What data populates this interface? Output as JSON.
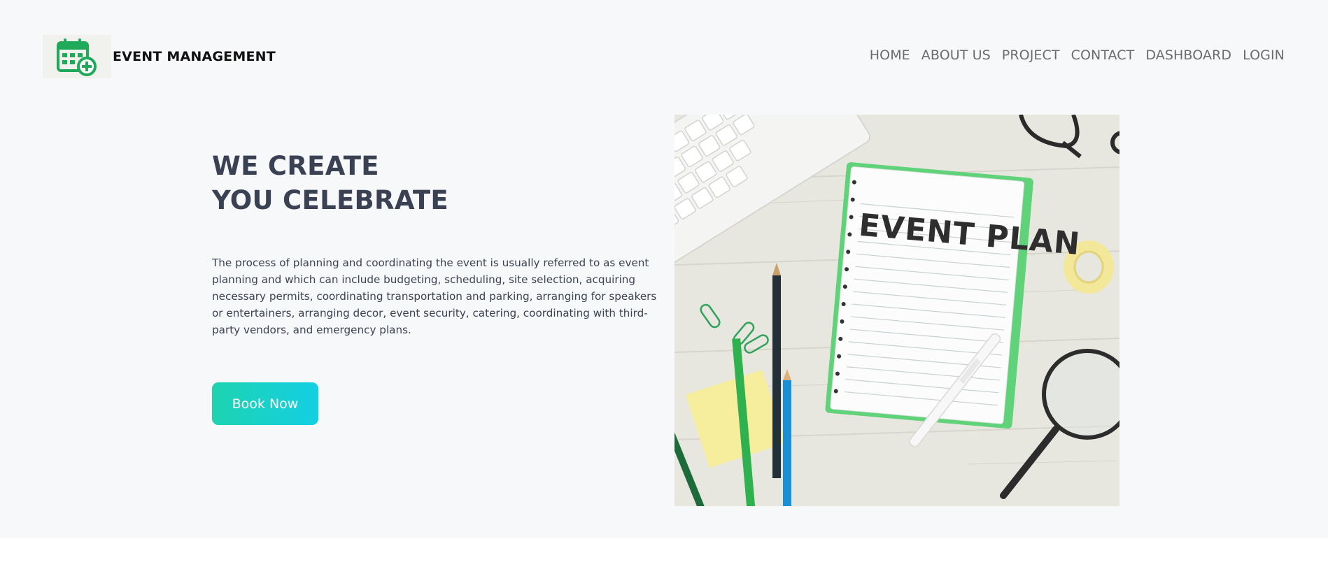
{
  "header": {
    "brand_name": "EVENT MANAGEMENT",
    "logo_icon": "calendar-plus-icon",
    "nav": [
      {
        "label": "HOME"
      },
      {
        "label": "ABOUT US"
      },
      {
        "label": "PROJECT"
      },
      {
        "label": "CONTACT"
      },
      {
        "label": "DASHBOARD"
      },
      {
        "label": "LOGIN"
      }
    ]
  },
  "hero": {
    "title_line1": "WE CREATE",
    "title_line2": "YOU CELEBRATE",
    "description": "The process of planning and coordinating the event is usually referred to as event planning and which can include budgeting, scheduling, site selection, acquiring necessary permits, coordinating transportation and parking, arranging for speakers or entertainers, arranging decor, event security, catering, coordinating with third-party vendors, and emergency plans.",
    "cta_label": "Book Now",
    "image": {
      "notebook_text": "EVENT PLAN"
    }
  },
  "colors": {
    "accent_start": "#1ed3b1",
    "accent_end": "#13cfe2",
    "logo_green": "#1faa59",
    "heading": "#3a4152",
    "background": "#f7f8fa"
  }
}
